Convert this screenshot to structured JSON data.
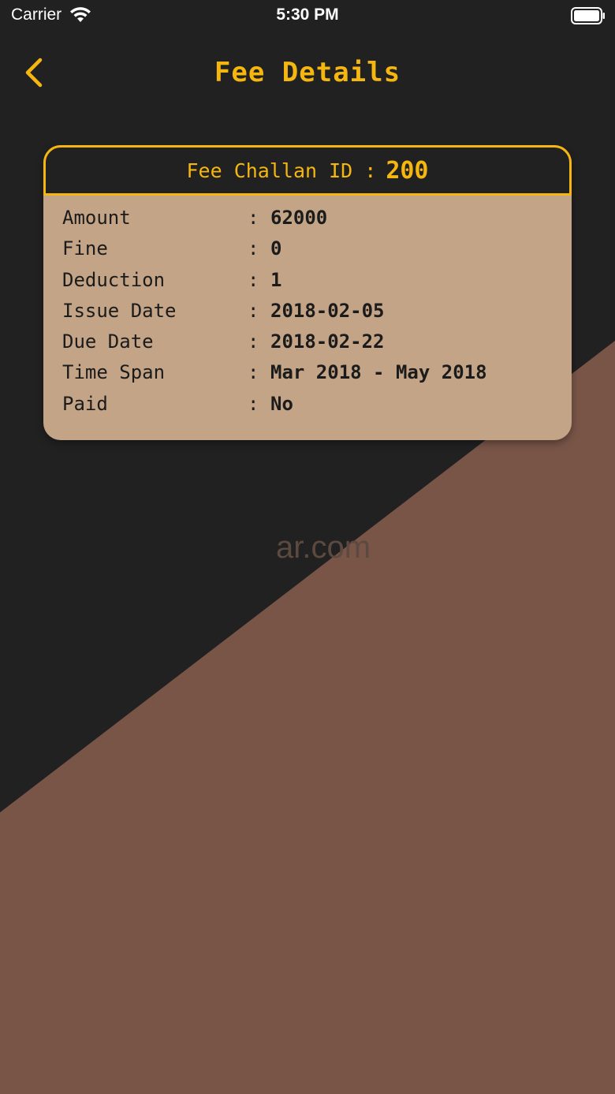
{
  "status_bar": {
    "carrier": "Carrier",
    "time": "5:30 PM",
    "wifi_icon": "wifi-icon",
    "battery_icon": "battery-icon"
  },
  "nav": {
    "title": "Fee Details",
    "back_icon": "chevron-left-icon"
  },
  "challan": {
    "label": "Fee Challan ID :",
    "id": "200",
    "separator": ":",
    "rows": [
      {
        "label": "Amount",
        "value": "62000"
      },
      {
        "label": "Fine",
        "value": "0"
      },
      {
        "label": "Deduction",
        "value": "1"
      },
      {
        "label": "Issue Date",
        "value": "2018-02-05"
      },
      {
        "label": "Due Date",
        "value": "2018-02-22"
      },
      {
        "label": "Time Span",
        "value": "Mar 2018 - May 2018"
      },
      {
        "label": "Paid",
        "value": "No"
      }
    ]
  },
  "watermark": "ar.com",
  "colors": {
    "background_dark": "#212121",
    "background_brown": "#795548",
    "accent": "#f5b60f",
    "card": "#c4a486"
  }
}
